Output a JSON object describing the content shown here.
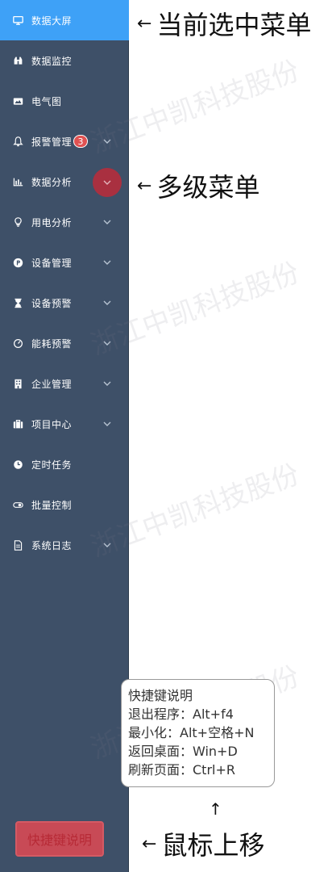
{
  "sidebar": {
    "items": [
      {
        "label": "数据大屏",
        "icon": "monitor-icon",
        "active": true,
        "chevron": false
      },
      {
        "label": "数据监控",
        "icon": "binoculars-icon",
        "chevron": false
      },
      {
        "label": "电气图",
        "icon": "image-icon",
        "chevron": false
      },
      {
        "label": "报警管理",
        "icon": "bell-icon",
        "chevron": true,
        "badge": "3"
      },
      {
        "label": "数据分析",
        "icon": "bar-chart-icon",
        "chevron": true,
        "highlighted": true
      },
      {
        "label": "用电分析",
        "icon": "bulb-icon",
        "chevron": true
      },
      {
        "label": "设备管理",
        "icon": "parking-icon",
        "chevron": true
      },
      {
        "label": "设备预警",
        "icon": "hourglass-icon",
        "chevron": true
      },
      {
        "label": "能耗预警",
        "icon": "gauge-icon",
        "chevron": true
      },
      {
        "label": "企业管理",
        "icon": "building-icon",
        "chevron": true
      },
      {
        "label": "项目中心",
        "icon": "briefcase-icon",
        "chevron": true
      },
      {
        "label": "定时任务",
        "icon": "clock-icon",
        "chevron": false
      },
      {
        "label": "批量控制",
        "icon": "toggle-icon",
        "chevron": false
      },
      {
        "label": "系统日志",
        "icon": "file-icon",
        "chevron": true
      }
    ],
    "shortcut_button": "快捷键说明"
  },
  "watermark": "浙江中凯科技股份",
  "annotations": {
    "current_menu": "当前选中菜单",
    "multilevel_menu": "多级菜单",
    "mouse_hover": "鼠标上移",
    "arrow_left": "←",
    "arrow_up": "↑"
  },
  "tooltip": {
    "lines": [
      "快捷键说明",
      "退出程序：Alt+f4",
      "最小化：Alt+空格+N",
      "返回桌面：Win+D",
      "刷新页面：Ctrl+R"
    ]
  },
  "colors": {
    "sidebar_bg": "#3e5068",
    "active_bg": "#3ea1f7",
    "badge_red": "#e05252",
    "highlight_circle": "#a93040",
    "shortcut_button_bg": "#c84a56"
  }
}
